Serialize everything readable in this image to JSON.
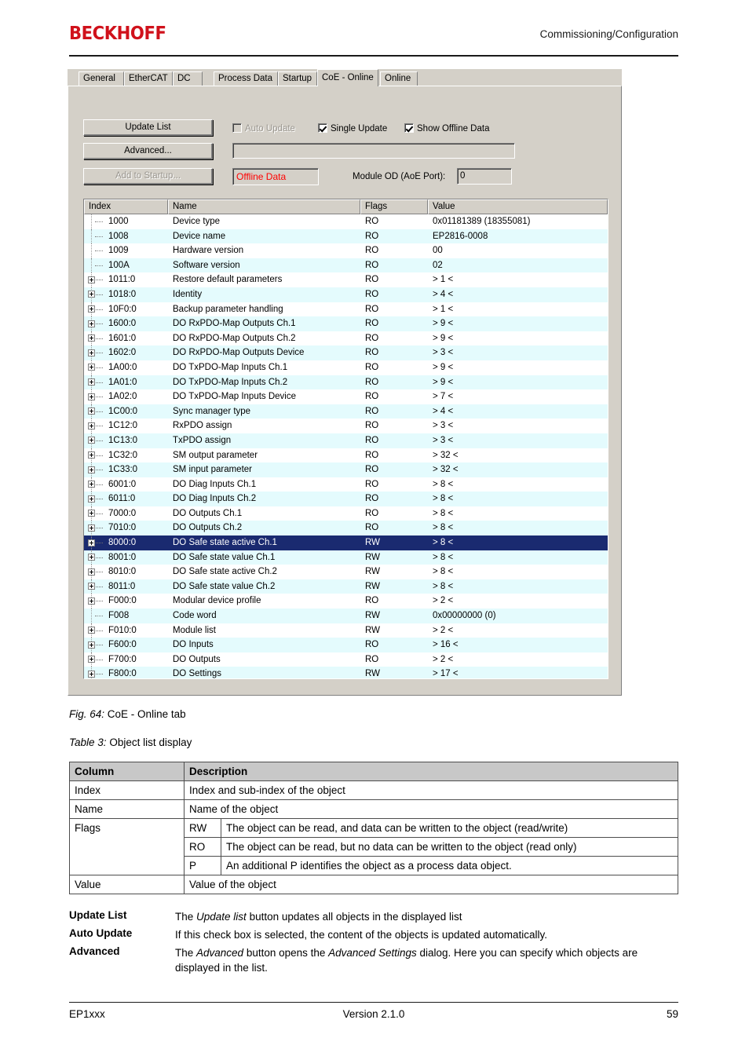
{
  "header": {
    "brand": "BECKHOFF",
    "section": "Commissioning/Configuration"
  },
  "screenshot": {
    "tabs": [
      {
        "label": "General",
        "active": false
      },
      {
        "label": "EtherCAT",
        "active": false
      },
      {
        "label": "DC",
        "active": false
      },
      {
        "label": "Process Data",
        "active": false
      },
      {
        "label": "Startup",
        "active": false
      },
      {
        "label": "CoE - Online",
        "active": true
      },
      {
        "label": "Online",
        "active": false
      }
    ],
    "buttons": {
      "update_list": "Update List",
      "advanced": "Advanced...",
      "add_to_startup": "Add to Startup..."
    },
    "checkboxes": [
      {
        "label": "Auto Update",
        "checked": false,
        "disabled": true
      },
      {
        "label": "Single Update",
        "checked": true,
        "disabled": false
      },
      {
        "label": "Show Offline Data",
        "checked": true,
        "disabled": false
      }
    ],
    "status_field_value": "",
    "offline_data_badge": "Offline Data",
    "offline_data_color": "#ff0000",
    "module_od_label": "Module OD (AoE Port):",
    "module_od_value": "0",
    "selection_color": "#1a2a70",
    "alt_row_color": "#e4fbfd",
    "list": {
      "columns": [
        "Index",
        "Name",
        "Flags",
        "Value"
      ],
      "rows": [
        {
          "index": "1000",
          "name": "Device type",
          "flags": "RO",
          "value": "0x01181389 (18355081)",
          "expandable": false,
          "selected": false
        },
        {
          "index": "1008",
          "name": "Device name",
          "flags": "RO",
          "value": "EP2816-0008",
          "expandable": false,
          "selected": false
        },
        {
          "index": "1009",
          "name": "Hardware version",
          "flags": "RO",
          "value": "00",
          "expandable": false,
          "selected": false
        },
        {
          "index": "100A",
          "name": "Software version",
          "flags": "RO",
          "value": "02",
          "expandable": false,
          "selected": false
        },
        {
          "index": "1011:0",
          "name": "Restore default parameters",
          "flags": "RO",
          "value": "> 1 <",
          "expandable": true,
          "selected": false
        },
        {
          "index": "1018:0",
          "name": "Identity",
          "flags": "RO",
          "value": "> 4 <",
          "expandable": true,
          "selected": false
        },
        {
          "index": "10F0:0",
          "name": "Backup parameter handling",
          "flags": "RO",
          "value": "> 1 <",
          "expandable": true,
          "selected": false
        },
        {
          "index": "1600:0",
          "name": "DO RxPDO-Map Outputs Ch.1",
          "flags": "RO",
          "value": "> 9 <",
          "expandable": true,
          "selected": false
        },
        {
          "index": "1601:0",
          "name": "DO RxPDO-Map Outputs Ch.2",
          "flags": "RO",
          "value": "> 9 <",
          "expandable": true,
          "selected": false
        },
        {
          "index": "1602:0",
          "name": "DO RxPDO-Map Outputs Device",
          "flags": "RO",
          "value": "> 3 <",
          "expandable": true,
          "selected": false
        },
        {
          "index": "1A00:0",
          "name": "DO TxPDO-Map Inputs Ch.1",
          "flags": "RO",
          "value": "> 9 <",
          "expandable": true,
          "selected": false
        },
        {
          "index": "1A01:0",
          "name": "DO TxPDO-Map Inputs Ch.2",
          "flags": "RO",
          "value": "> 9 <",
          "expandable": true,
          "selected": false
        },
        {
          "index": "1A02:0",
          "name": "DO TxPDO-Map Inputs Device",
          "flags": "RO",
          "value": "> 7 <",
          "expandable": true,
          "selected": false
        },
        {
          "index": "1C00:0",
          "name": "Sync manager type",
          "flags": "RO",
          "value": "> 4 <",
          "expandable": true,
          "selected": false
        },
        {
          "index": "1C12:0",
          "name": "RxPDO assign",
          "flags": "RO",
          "value": "> 3 <",
          "expandable": true,
          "selected": false
        },
        {
          "index": "1C13:0",
          "name": "TxPDO assign",
          "flags": "RO",
          "value": "> 3 <",
          "expandable": true,
          "selected": false
        },
        {
          "index": "1C32:0",
          "name": "SM output parameter",
          "flags": "RO",
          "value": "> 32 <",
          "expandable": true,
          "selected": false
        },
        {
          "index": "1C33:0",
          "name": "SM input parameter",
          "flags": "RO",
          "value": "> 32 <",
          "expandable": true,
          "selected": false
        },
        {
          "index": "6001:0",
          "name": "DO Diag Inputs Ch.1",
          "flags": "RO",
          "value": "> 8 <",
          "expandable": true,
          "selected": false
        },
        {
          "index": "6011:0",
          "name": "DO Diag Inputs Ch.2",
          "flags": "RO",
          "value": "> 8 <",
          "expandable": true,
          "selected": false
        },
        {
          "index": "7000:0",
          "name": "DO Outputs Ch.1",
          "flags": "RO",
          "value": "> 8 <",
          "expandable": true,
          "selected": false
        },
        {
          "index": "7010:0",
          "name": "DO Outputs Ch.2",
          "flags": "RO",
          "value": "> 8 <",
          "expandable": true,
          "selected": false
        },
        {
          "index": "8000:0",
          "name": "DO Safe state active Ch.1",
          "flags": "RW",
          "value": "> 8 <",
          "expandable": true,
          "selected": true
        },
        {
          "index": "8001:0",
          "name": "DO Safe state value Ch.1",
          "flags": "RW",
          "value": "> 8 <",
          "expandable": true,
          "selected": false
        },
        {
          "index": "8010:0",
          "name": "DO Safe state active Ch.2",
          "flags": "RW",
          "value": "> 8 <",
          "expandable": true,
          "selected": false
        },
        {
          "index": "8011:0",
          "name": "DO Safe state value Ch.2",
          "flags": "RW",
          "value": "> 8 <",
          "expandable": true,
          "selected": false
        },
        {
          "index": "F000:0",
          "name": "Modular device profile",
          "flags": "RO",
          "value": "> 2 <",
          "expandable": true,
          "selected": false
        },
        {
          "index": "F008",
          "name": "Code word",
          "flags": "RW",
          "value": "0x00000000 (0)",
          "expandable": false,
          "selected": false
        },
        {
          "index": "F010:0",
          "name": "Module list",
          "flags": "RW",
          "value": "> 2 <",
          "expandable": true,
          "selected": false
        },
        {
          "index": "F600:0",
          "name": "DO Inputs",
          "flags": "RO",
          "value": "> 16 <",
          "expandable": true,
          "selected": false
        },
        {
          "index": "F700:0",
          "name": "DO Outputs",
          "flags": "RO",
          "value": "> 2 <",
          "expandable": true,
          "selected": false
        },
        {
          "index": "F800:0",
          "name": "DO Settings",
          "flags": "RW",
          "value": "> 17 <",
          "expandable": true,
          "selected": false
        }
      ]
    }
  },
  "fig_caption": {
    "label": "Fig. 64:",
    "text": "CoE - Online tab"
  },
  "table_caption": {
    "label": "Table 3:",
    "text": "Object list display"
  },
  "doc_table": {
    "headers": [
      "Column",
      "Description"
    ],
    "rows": [
      {
        "column": "Index",
        "description": "Index and sub-index of the object"
      },
      {
        "column": "Name",
        "description": "Name of the object"
      },
      {
        "column": "Flags",
        "subrows": [
          {
            "flag": "RW",
            "description": "The object can be read, and data can be written to the object (read/write)"
          },
          {
            "flag": "RO",
            "description": "The object can be read, but no data can be written to the object (read only)"
          },
          {
            "flag": "P",
            "description": "An additional P identifies the object as a process data object."
          }
        ]
      },
      {
        "column": "Value",
        "description": "Value of the object"
      }
    ]
  },
  "definitions": [
    {
      "term": "Update List",
      "desc_parts": [
        {
          "t": "The ",
          "i": false
        },
        {
          "t": "Update list",
          "i": true
        },
        {
          "t": " button updates all objects in the displayed list",
          "i": false
        }
      ]
    },
    {
      "term": "Auto Update",
      "desc_parts": [
        {
          "t": "If this check box is selected, the content of the objects is updated automatically.",
          "i": false
        }
      ]
    },
    {
      "term": "Advanced",
      "desc_parts": [
        {
          "t": "The ",
          "i": false
        },
        {
          "t": "Advanced",
          "i": true
        },
        {
          "t": " button opens the ",
          "i": false
        },
        {
          "t": "Advanced Settings",
          "i": true
        },
        {
          "t": " dialog. Here you can specify which objects are displayed in the list.",
          "i": false
        }
      ]
    }
  ],
  "footer": {
    "left": "EP1xxx",
    "middle": "Version 2.1.0",
    "right": "59"
  }
}
